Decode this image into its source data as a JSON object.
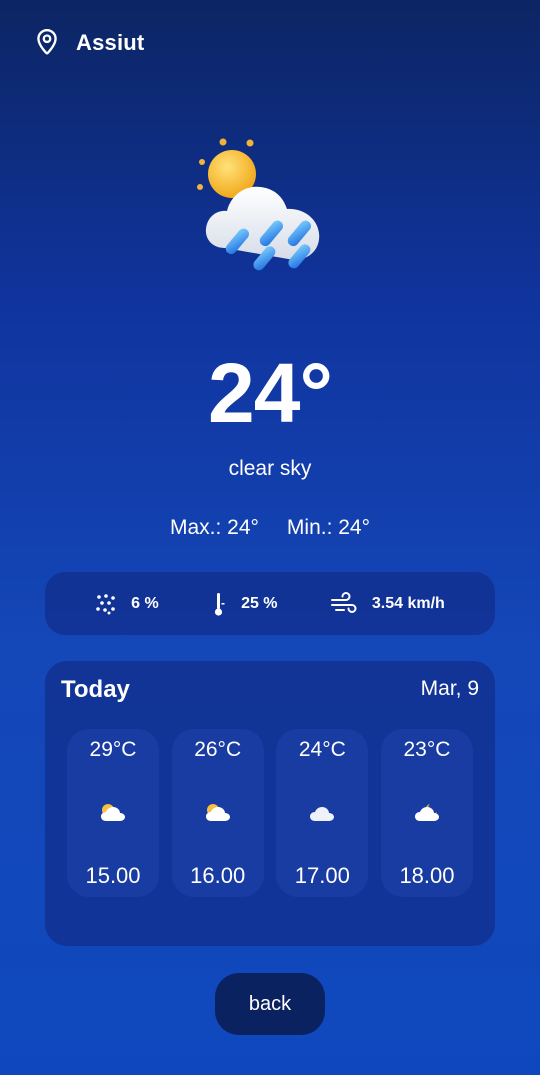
{
  "location": {
    "city": "Assiut",
    "icon": "location-pin-icon"
  },
  "current": {
    "icon": "sun-cloud-rain-icon",
    "temperature": "24°",
    "description": "clear sky",
    "max": "Max.: 24°",
    "min": "Min.: 24°"
  },
  "stats": [
    {
      "icon": "precipitation-icon",
      "value": "6 %"
    },
    {
      "icon": "thermometer-icon",
      "value": "25 %"
    },
    {
      "icon": "wind-icon",
      "value": "3.54 km/h"
    }
  ],
  "today": {
    "title": "Today",
    "date": "Mar, 9",
    "hours": [
      {
        "temp": "29°C",
        "icon": "partly-cloudy-icon",
        "time": "15.00"
      },
      {
        "temp": "26°C",
        "icon": "partly-cloudy-icon",
        "time": "16.00"
      },
      {
        "temp": "24°C",
        "icon": "cloud-icon",
        "time": "17.00"
      },
      {
        "temp": "23°C",
        "icon": "partly-cloudy-night-icon",
        "time": "18.00"
      }
    ]
  },
  "back_label": "back",
  "colors": {
    "background_top": "#0c2563",
    "background_bottom": "#0f48be",
    "card": "#122e8c",
    "button": "#0b2260"
  }
}
